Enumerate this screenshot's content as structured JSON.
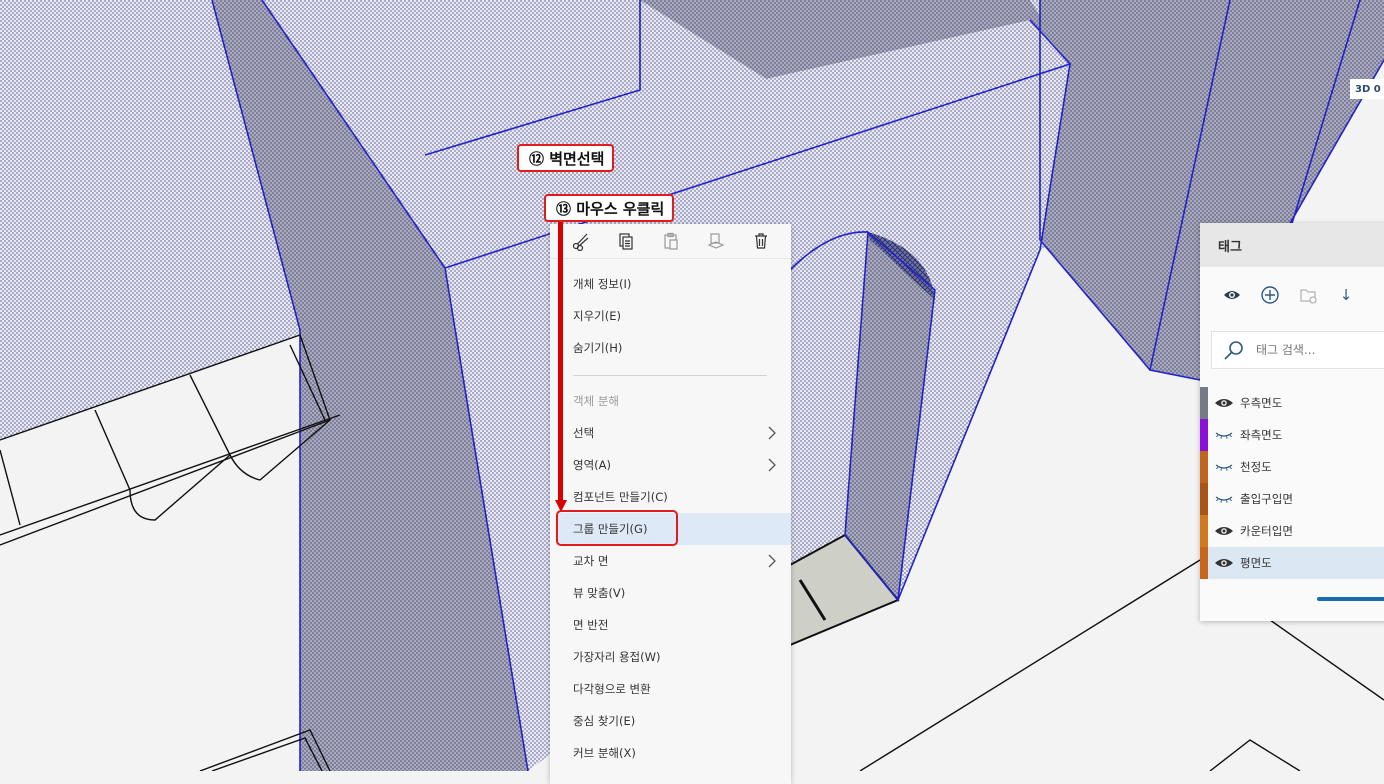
{
  "callouts": {
    "step12": "⑫ 벽면선택",
    "step13": "⑬ 마우스 우클릭"
  },
  "viewport": {
    "label_3d": "3D 0"
  },
  "context_menu": {
    "toolbar_icons": [
      "scissors-icon",
      "copy-icon",
      "paste-icon",
      "paste-in-place-icon",
      "trash-icon"
    ],
    "items": [
      {
        "label": "개체 정보(I)"
      },
      {
        "label": "지우기(E)"
      },
      {
        "label": "숨기기(H)"
      },
      {
        "label": "객체 분해"
      },
      {
        "label": "선택"
      },
      {
        "label": "영역(A)"
      },
      {
        "label": "컴포넌트 만들기(C)"
      },
      {
        "label": "그룹 만들기(G)"
      },
      {
        "label": "교차 면"
      },
      {
        "label": "뷰 맞춤(V)"
      },
      {
        "label": "면 반전"
      },
      {
        "label": "가장자리 용접(W)"
      },
      {
        "label": "다각형으로 변환"
      },
      {
        "label": "중심 찾기(E)"
      },
      {
        "label": "커브 분해(X)"
      }
    ]
  },
  "tag_panel": {
    "title": "태그",
    "sort_glyph": "↓",
    "search_placeholder": "태그 검색...",
    "tags": [
      {
        "name": "우측면도",
        "color": "#777a86",
        "visible": true
      },
      {
        "name": "좌측면도",
        "color": "#8a12d6",
        "visible": false
      },
      {
        "name": "천정도",
        "color": "#c0651f",
        "visible": false
      },
      {
        "name": "출입구입면",
        "color": "#a95418",
        "visible": false
      },
      {
        "name": "카운터입면",
        "color": "#d2781e",
        "visible": true
      },
      {
        "name": "평면도",
        "color": "#c8661c",
        "visible": true,
        "selected": true
      }
    ]
  }
}
